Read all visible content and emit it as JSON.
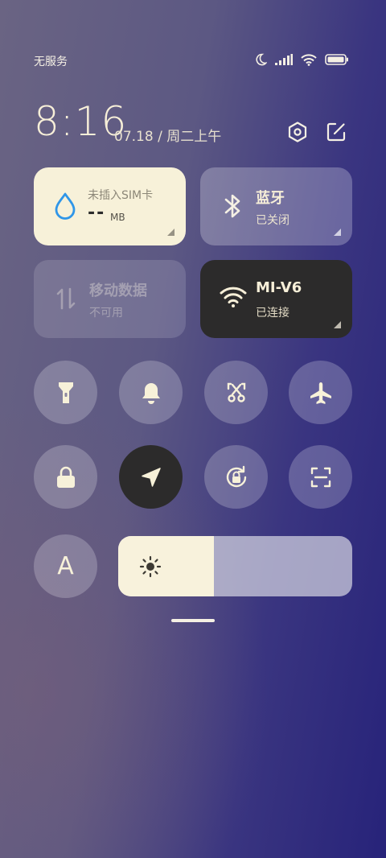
{
  "status_bar": {
    "carrier": "无服务",
    "icons": [
      "moon-icon",
      "signal-icon",
      "wifi-icon",
      "battery-icon"
    ]
  },
  "header": {
    "time": "8:16",
    "date": "07.18 / 周二上午",
    "icons": [
      "settings-icon",
      "edit-icon"
    ]
  },
  "tiles": {
    "data_usage": {
      "title": "未插入SIM卡",
      "value": "--",
      "unit": "MB",
      "icon": "water-drop-icon"
    },
    "bluetooth": {
      "title": "蓝牙",
      "status": "已关闭",
      "icon": "bluetooth-icon"
    },
    "mobile_data": {
      "title": "移动数据",
      "status": "不可用",
      "icon": "data-arrows-icon"
    },
    "wifi": {
      "title": "MI-V6",
      "status": "已连接",
      "icon": "wifi-icon"
    }
  },
  "toggles_row1": [
    "flashlight-icon",
    "bell-icon",
    "screenshot-icon",
    "airplane-icon"
  ],
  "toggles_row2": [
    "lock-icon",
    "location-icon",
    "rotation-lock-icon",
    "scan-icon"
  ],
  "auto_brightness": {
    "label": "A"
  },
  "brightness": {
    "level": 0.41,
    "icon": "sun-icon"
  },
  "colors": {
    "tile_active": "#f7f1d9",
    "tile_dark": "#2c2b2b",
    "accent_blue": "#2f96e8"
  }
}
